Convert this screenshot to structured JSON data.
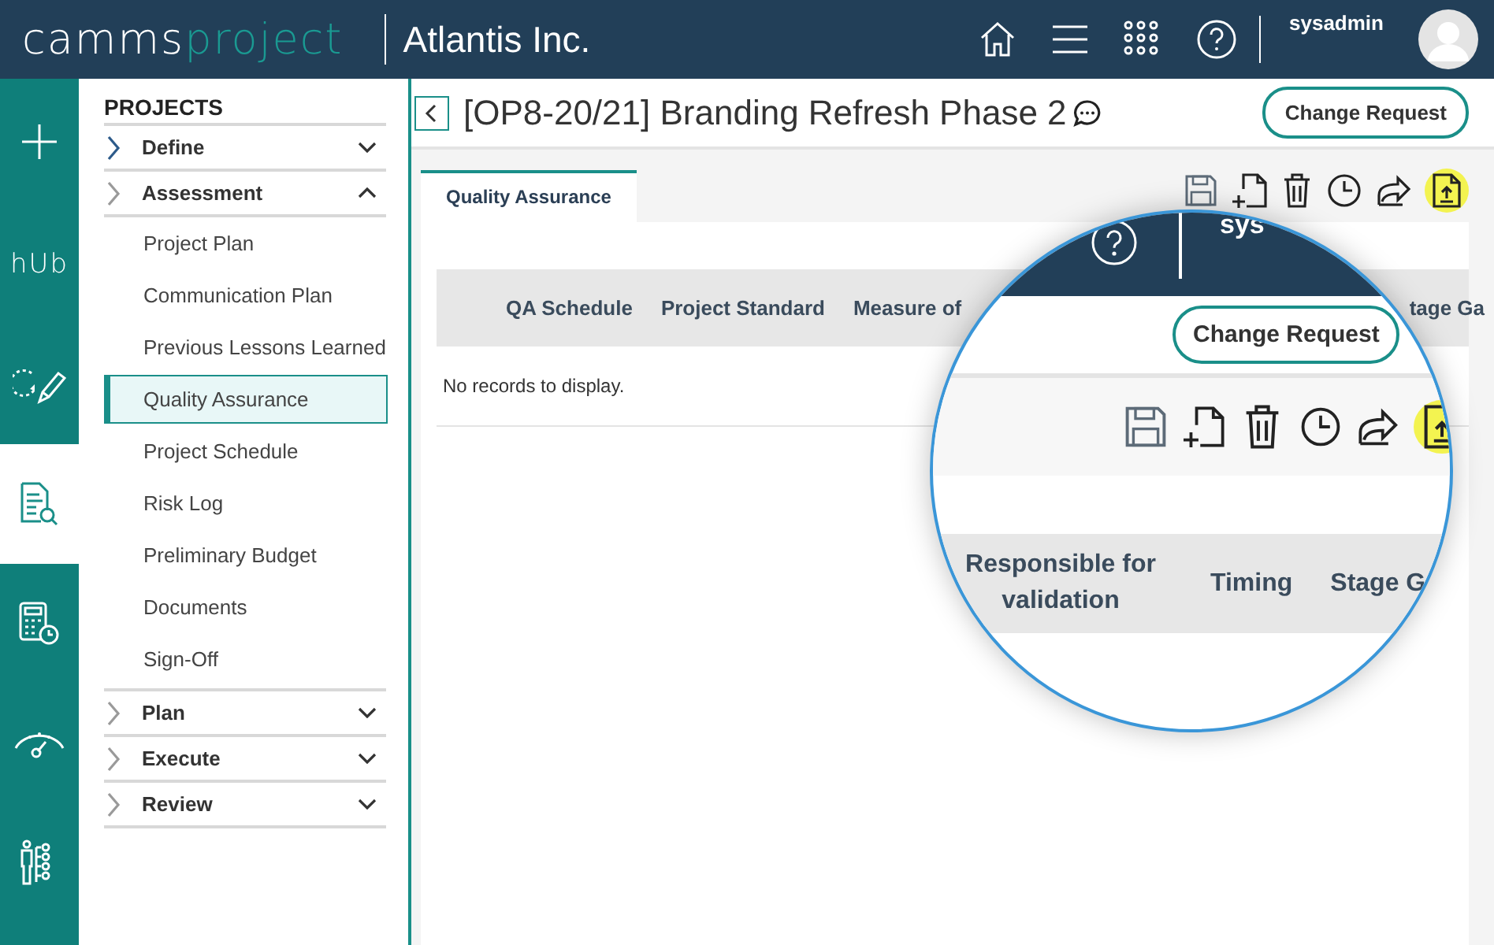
{
  "header": {
    "logo_plain": "camms",
    "logo_accent": "project",
    "organization": "Atlantis Inc.",
    "user": "sysadmin"
  },
  "rail": [
    {
      "kind": "plus",
      "selected": false
    },
    {
      "kind": "text",
      "text": "hUb",
      "selected": false
    },
    {
      "kind": "pencil",
      "selected": false
    },
    {
      "kind": "doc-search",
      "selected": true
    },
    {
      "kind": "calculator",
      "selected": false
    },
    {
      "kind": "gauge",
      "selected": false
    },
    {
      "kind": "people",
      "selected": false
    }
  ],
  "sidebar": {
    "heading": "PROJECTS",
    "sections": [
      {
        "label": "Define",
        "expanded": false
      },
      {
        "label": "Assessment",
        "expanded": true,
        "children": [
          {
            "label": "Project Plan",
            "selected": false
          },
          {
            "label": "Communication Plan",
            "selected": false
          },
          {
            "label": "Previous Lessons Learned",
            "selected": false
          },
          {
            "label": "Quality Assurance",
            "selected": true
          },
          {
            "label": "Project Schedule",
            "selected": false
          },
          {
            "label": "Risk Log",
            "selected": false
          },
          {
            "label": "Preliminary Budget",
            "selected": false
          },
          {
            "label": "Documents",
            "selected": false
          },
          {
            "label": "Sign-Off",
            "selected": false
          }
        ]
      },
      {
        "label": "Plan",
        "expanded": false
      },
      {
        "label": "Execute",
        "expanded": false
      },
      {
        "label": "Review",
        "expanded": false
      }
    ]
  },
  "page": {
    "title": "[OP8-20/21] Branding Refresh Phase 2",
    "change_request": "Change Request",
    "tabs": [
      {
        "label": "Quality Assurance",
        "selected": true
      }
    ],
    "toolbar": [
      {
        "kind": "save",
        "highlighted": false
      },
      {
        "kind": "new",
        "highlighted": false
      },
      {
        "kind": "delete",
        "highlighted": false
      },
      {
        "kind": "history",
        "highlighted": false
      },
      {
        "kind": "share",
        "highlighted": false
      },
      {
        "kind": "upload",
        "highlighted": true
      }
    ],
    "table": {
      "columns": [
        "QA Schedule",
        "Project Standard",
        "Measure of",
        "tage Ga"
      ],
      "empty_message": "No records to display."
    }
  },
  "magnifier": {
    "user": "sys",
    "change_request": "Change Request",
    "toolbar": [
      {
        "kind": "save",
        "highlighted": false
      },
      {
        "kind": "new",
        "highlighted": false
      },
      {
        "kind": "delete",
        "highlighted": false
      },
      {
        "kind": "history",
        "highlighted": false
      },
      {
        "kind": "share",
        "highlighted": false
      },
      {
        "kind": "upload",
        "highlighted": true
      }
    ],
    "columns": [
      "Responsible for validation",
      "Timing",
      "Stage G"
    ]
  }
}
